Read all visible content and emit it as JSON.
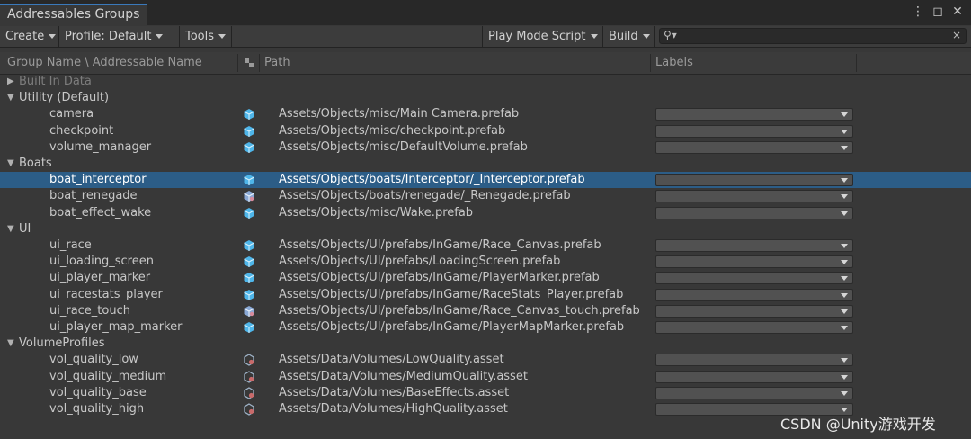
{
  "window": {
    "tab_title": "Addressables Groups",
    "icons": [
      "more-icon",
      "maximize-icon",
      "close-icon"
    ]
  },
  "toolbar": {
    "create": "Create",
    "profile": "Profile: Default",
    "tools": "Tools",
    "play_mode_script": "Play Mode Script",
    "build": "Build",
    "search_placeholder": ""
  },
  "columns": {
    "name": "Group Name \\ Addressable Name",
    "path": "Path",
    "labels": "Labels"
  },
  "groups": [
    {
      "label": "Built In Data",
      "expanded": false,
      "entries": []
    },
    {
      "label": "Utility (Default)",
      "expanded": true,
      "entries": [
        {
          "name": "camera",
          "path": "Assets/Objects/misc/Main Camera.prefab",
          "icon": "prefab-icon"
        },
        {
          "name": "checkpoint",
          "path": "Assets/Objects/misc/checkpoint.prefab",
          "icon": "prefab-icon"
        },
        {
          "name": "volume_manager",
          "path": "Assets/Objects/misc/DefaultVolume.prefab",
          "icon": "prefab-icon"
        }
      ]
    },
    {
      "label": "Boats",
      "expanded": true,
      "entries": [
        {
          "name": "boat_interceptor",
          "path": "Assets/Objects/boats/Interceptor/_Interceptor.prefab",
          "icon": "prefab-icon",
          "selected": true
        },
        {
          "name": "boat_renegade",
          "path": "Assets/Objects/boats/renegade/_Renegade.prefab",
          "icon": "prefab-variant-icon"
        },
        {
          "name": "boat_effect_wake",
          "path": "Assets/Objects/misc/Wake.prefab",
          "icon": "prefab-icon"
        }
      ]
    },
    {
      "label": "UI",
      "expanded": true,
      "entries": [
        {
          "name": "ui_race",
          "path": "Assets/Objects/UI/prefabs/InGame/Race_Canvas.prefab",
          "icon": "prefab-icon"
        },
        {
          "name": "ui_loading_screen",
          "path": "Assets/Objects/UI/prefabs/LoadingScreen.prefab",
          "icon": "prefab-icon"
        },
        {
          "name": "ui_player_marker",
          "path": "Assets/Objects/UI/prefabs/InGame/PlayerMarker.prefab",
          "icon": "prefab-icon"
        },
        {
          "name": "ui_racestats_player",
          "path": "Assets/Objects/UI/prefabs/InGame/RaceStats_Player.prefab",
          "icon": "prefab-icon"
        },
        {
          "name": "ui_race_touch",
          "path": "Assets/Objects/UI/prefabs/InGame/Race_Canvas_touch.prefab",
          "icon": "prefab-variant-icon"
        },
        {
          "name": "ui_player_map_marker",
          "path": "Assets/Objects/UI/prefabs/InGame/PlayerMapMarker.prefab",
          "icon": "prefab-icon"
        }
      ]
    },
    {
      "label": "VolumeProfiles",
      "expanded": true,
      "entries": [
        {
          "name": "vol_quality_low",
          "path": "Assets/Data/Volumes/LowQuality.asset",
          "icon": "volume-asset-icon"
        },
        {
          "name": "vol_quality_medium",
          "path": "Assets/Data/Volumes/MediumQuality.asset",
          "icon": "volume-asset-icon"
        },
        {
          "name": "vol_quality_base",
          "path": "Assets/Data/Volumes/BaseEffects.asset",
          "icon": "volume-asset-icon"
        },
        {
          "name": "vol_quality_high",
          "path": "Assets/Data/Volumes/HighQuality.asset",
          "icon": "volume-asset-icon"
        }
      ]
    }
  ],
  "colors": {
    "accent": "#3a79bb",
    "selection": "#2c5d87",
    "prefab": "#4fb6ea",
    "variant": "#8aa9d6",
    "asset": "#c96a6a"
  },
  "watermark": "CSDN @Unity游戏开发"
}
